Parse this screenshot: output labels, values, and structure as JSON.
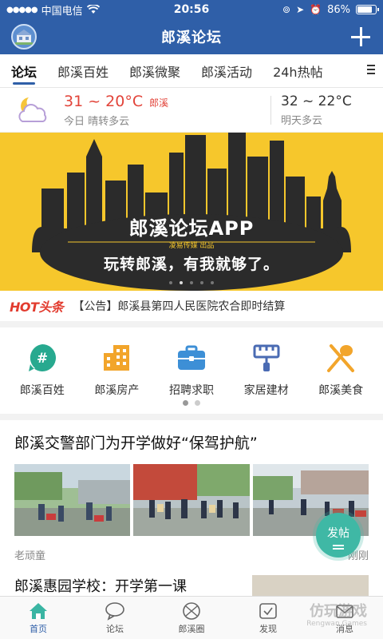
{
  "status": {
    "carrier": "中国电信",
    "time": "20:56",
    "battery": "86%",
    "battery_level": 0.86
  },
  "nav": {
    "title": "郎溪论坛",
    "avatar_icon": "forum-logo-icon",
    "add_icon": "plus-icon"
  },
  "tabs": [
    {
      "label": "论坛",
      "active": true
    },
    {
      "label": "郎溪百姓"
    },
    {
      "label": "郎溪微聚"
    },
    {
      "label": "郎溪活动"
    },
    {
      "label": "24h热帖"
    }
  ],
  "weather": {
    "today_temp": "31 ~ 20°C",
    "city": "郎溪",
    "today_desc": "今日  晴转多云",
    "tomorrow_temp": "32 ~ 22°C",
    "tomorrow_desc": "明天多云"
  },
  "banner": {
    "title": "郎溪论坛APP",
    "publisher": "凌易传媒   出品",
    "slogan": "玩转郎溪，有我就够了。",
    "page_count": 5,
    "active_page": 1
  },
  "notice": {
    "tag": "HOT头条",
    "text": "【公告】郎溪县第四人民医院农合即时结算"
  },
  "quick_links": [
    {
      "label": "郎溪百姓",
      "icon": "hash-icon",
      "color": "#27a98f"
    },
    {
      "label": "郎溪房产",
      "icon": "building-icon",
      "color": "#f2a52b"
    },
    {
      "label": "招聘求职",
      "icon": "briefcase-icon",
      "color": "#3d8fd6"
    },
    {
      "label": "家居建材",
      "icon": "paint-roller-icon",
      "color": "#4a6bb3"
    },
    {
      "label": "郎溪美食",
      "icon": "utensils-icon",
      "color": "#f2a52b"
    }
  ],
  "posts": [
    {
      "title": "郎溪交警部门为开学做好“保驾护航”",
      "author": "老顽童",
      "time": "刚刚"
    },
    {
      "title": "郎溪惠园学校：开学第一课"
    }
  ],
  "fab": {
    "label": "发帖"
  },
  "bottom_nav": [
    {
      "label": "首页",
      "icon": "home-icon",
      "active": true
    },
    {
      "label": "论坛",
      "icon": "chat-icon"
    },
    {
      "label": "郎溪圈",
      "icon": "circle-icon"
    },
    {
      "label": "发现",
      "icon": "discover-icon"
    },
    {
      "label": "消息",
      "icon": "message-icon"
    }
  ],
  "watermark": {
    "text": "仿玩游戏",
    "sub": "Rengwan Games"
  }
}
